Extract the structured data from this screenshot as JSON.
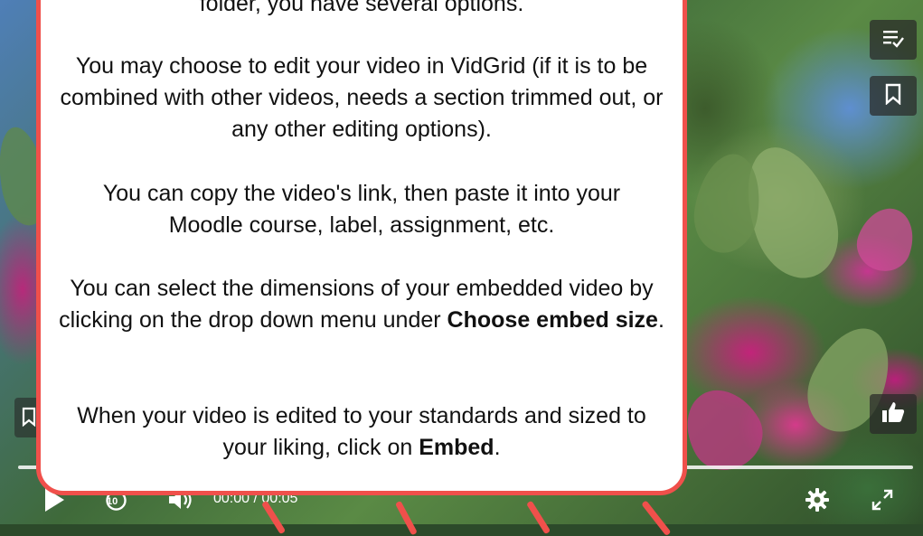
{
  "video": {
    "time_current": "00:00",
    "time_separator": "/",
    "time_total": "00:05",
    "skip_label": "10",
    "progress": 0
  },
  "callout": {
    "line1": "folder, you have several options.",
    "para2": "You may choose to edit your video in VidGrid (if it is to be combined with other videos, needs a section trimmed out, or any other editing options).",
    "para3": "You can copy the video's link, then paste it into your Moodle course, label, assignment, etc.",
    "para4_start": "You can select the dimensions of your embedded video by clicking on the drop down menu under",
    "para4_bold": "Choose embed size",
    "para4_end": ".",
    "para5_start": "When your video is edited to your standards and sized to your liking, click on",
    "para5_bold": "Embed",
    "para5_end": "."
  },
  "icons": {
    "queue": "playlist-check-icon",
    "bookmark": "bookmark-icon",
    "like": "thumbs-up-icon",
    "play": "play-icon",
    "replay": "replay-10-icon",
    "volume": "volume-icon",
    "settings": "gear-icon",
    "fullscreen": "fullscreen-icon"
  },
  "colors": {
    "callout_border": "#f0504b",
    "callout_background": "#ffffff",
    "overlay_button": "#282828"
  }
}
